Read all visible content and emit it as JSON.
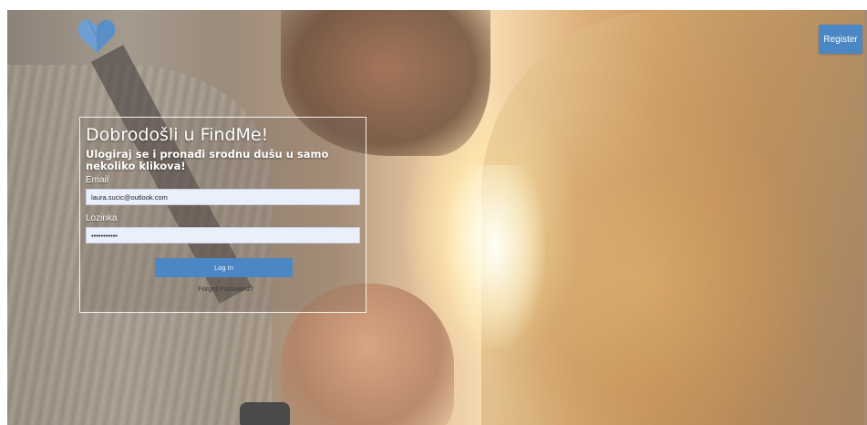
{
  "brand": {
    "logo_icon": "heart-logo-icon",
    "logo_color": "#5b8fc7"
  },
  "header": {
    "register_label": "Register"
  },
  "login": {
    "title": "Dobrodošli u FindMe!",
    "subtitle": "Ulogiraj se i pronađi srodnu dušu u samo nekoliko klikova!",
    "email_label": "Email",
    "email_value": "laura.sucic@outlook.com",
    "password_label": "Lozinka",
    "password_value": "•••••••••••",
    "login_label": "Log In",
    "forgot_label": "Forgot Password?"
  },
  "colors": {
    "accent": "#4a87c4",
    "input_bg": "#eaf0fb"
  }
}
